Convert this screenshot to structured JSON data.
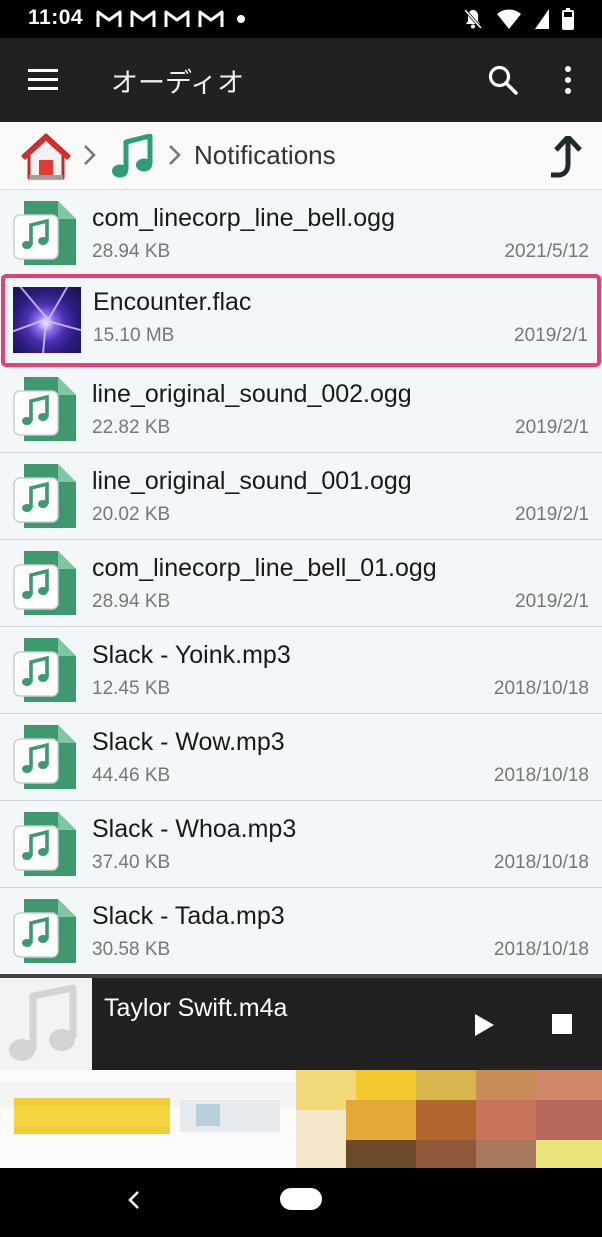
{
  "status_bar": {
    "time": "11:04"
  },
  "app_bar": {
    "title": "オーディオ"
  },
  "breadcrumb": {
    "current": "Notifications"
  },
  "files": [
    {
      "name": "com_linecorp_line_bell.ogg",
      "size": "28.94 KB",
      "date": "2021/5/12",
      "icon": "audio-file-icon"
    },
    {
      "name": "Encounter.flac",
      "size": "15.10 MB",
      "date": "2019/2/1",
      "icon": "album-art-thumbnail",
      "selected": true
    },
    {
      "name": "line_original_sound_002.ogg",
      "size": "22.82 KB",
      "date": "2019/2/1",
      "icon": "audio-file-icon"
    },
    {
      "name": "line_original_sound_001.ogg",
      "size": "20.02 KB",
      "date": "2019/2/1",
      "icon": "audio-file-icon"
    },
    {
      "name": "com_linecorp_line_bell_01.ogg",
      "size": "28.94 KB",
      "date": "2019/2/1",
      "icon": "audio-file-icon"
    },
    {
      "name": "Slack - Yoink.mp3",
      "size": "12.45 KB",
      "date": "2018/10/18",
      "icon": "audio-file-icon"
    },
    {
      "name": "Slack - Wow.mp3",
      "size": "44.46 KB",
      "date": "2018/10/18",
      "icon": "audio-file-icon"
    },
    {
      "name": "Slack - Whoa.mp3",
      "size": "37.40 KB",
      "date": "2018/10/18",
      "icon": "audio-file-icon"
    },
    {
      "name": "Slack - Tada.mp3",
      "size": "30.58 KB",
      "date": "2018/10/18",
      "icon": "audio-file-icon"
    }
  ],
  "player": {
    "title": "Taylor Swift.m4a"
  },
  "colors": {
    "app_bar": "#212121",
    "list_bg": "#f3f7f9",
    "selection_border": "#e83e73",
    "file_icon_green": "#3e9a6e"
  }
}
